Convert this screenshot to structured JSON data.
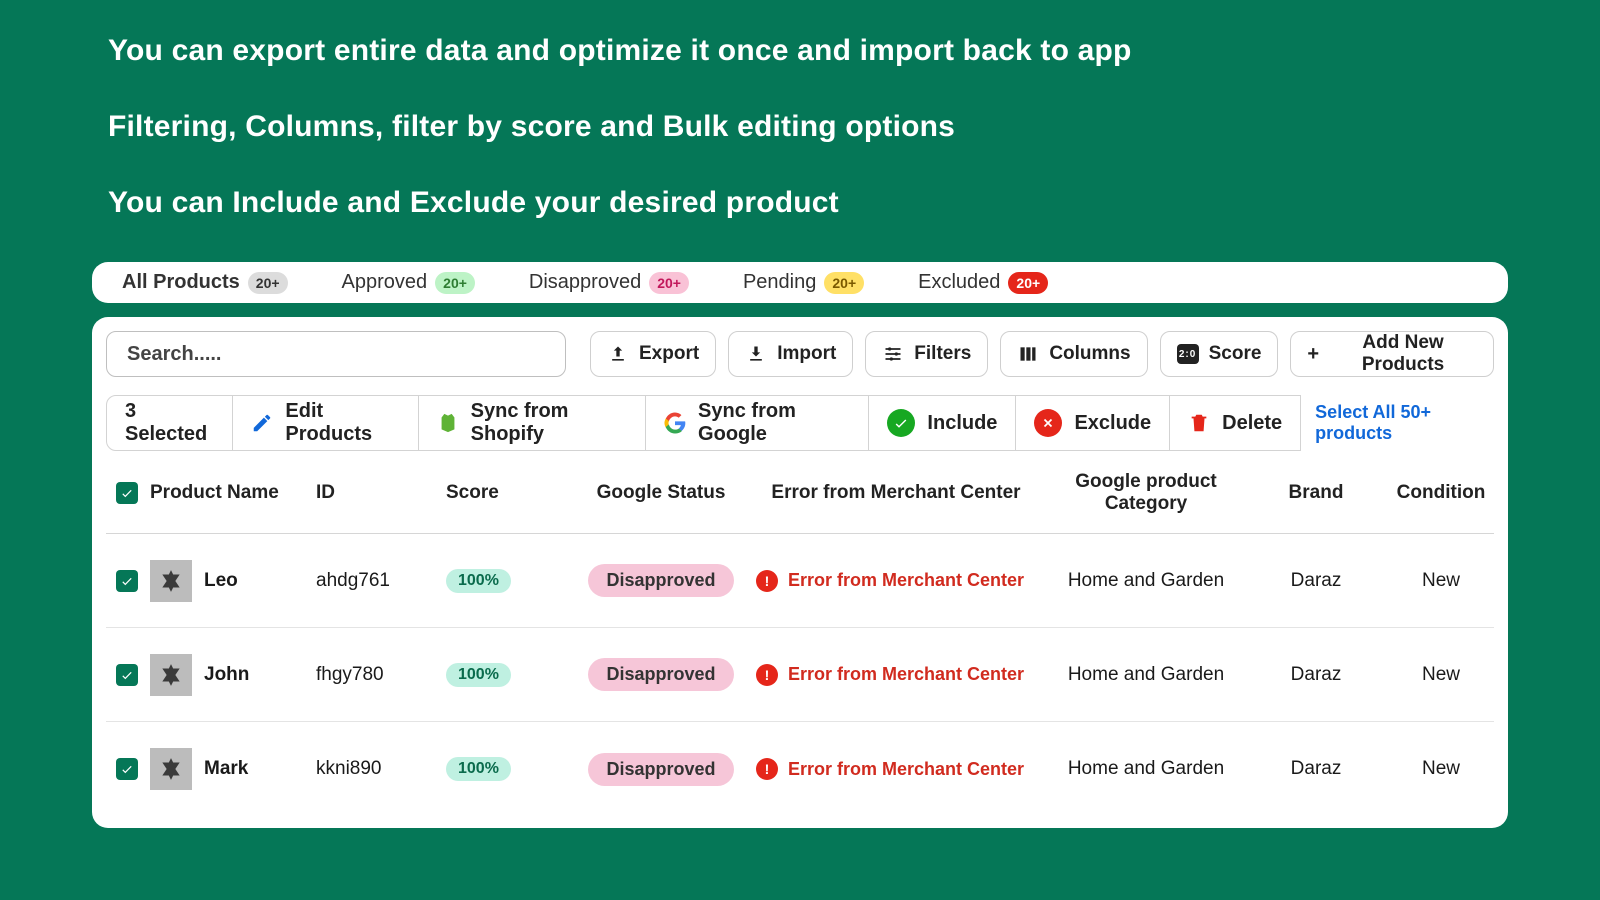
{
  "header": {
    "line1": "You can export entire data and optimize it once and import back to app",
    "line2": "Filtering, Columns, filter by score and Bulk editing options",
    "line3": "You can Include and Exclude your desired product"
  },
  "tabs": [
    {
      "label": "All Products",
      "count": "20+",
      "style": "gray"
    },
    {
      "label": "Approved",
      "count": "20+",
      "style": "green"
    },
    {
      "label": "Disapproved",
      "count": "20+",
      "style": "pink"
    },
    {
      "label": "Pending",
      "count": "20+",
      "style": "yellow"
    },
    {
      "label": "Excluded",
      "count": "20+",
      "style": "red"
    }
  ],
  "toolbar": {
    "search_placeholder": "Search.....",
    "export": "Export",
    "import": "Import",
    "filters": "Filters",
    "columns": "Columns",
    "score": "Score",
    "add_new": "Add New Products"
  },
  "actions": {
    "selected": "3 Selected",
    "edit": "Edit Products",
    "sync_shopify": "Sync from Shopify",
    "sync_google": "Sync from Google",
    "include": "Include",
    "exclude": "Exclude",
    "delete": "Delete",
    "select_all": "Select All 50+ products"
  },
  "columns": {
    "product_name": "Product Name",
    "id": "ID",
    "score": "Score",
    "google_status": "Google Status",
    "error": "Error from Merchant Center",
    "category": "Google product Category",
    "brand": "Brand",
    "condition": "Condition"
  },
  "rows": [
    {
      "name": "Leo",
      "id": "ahdg761",
      "score": "100%",
      "status": "Disapproved",
      "error": "Error from Merchant Center",
      "category": "Home and Garden",
      "brand": "Daraz",
      "condition": "New"
    },
    {
      "name": "John",
      "id": "fhgy780",
      "score": "100%",
      "status": "Disapproved",
      "error": "Error from Merchant Center",
      "category": "Home and Garden",
      "brand": "Daraz",
      "condition": "New"
    },
    {
      "name": "Mark",
      "id": "kkni890",
      "score": "100%",
      "status": "Disapproved",
      "error": "Error from Merchant Center",
      "category": "Home and Garden",
      "brand": "Daraz",
      "condition": "New"
    }
  ]
}
